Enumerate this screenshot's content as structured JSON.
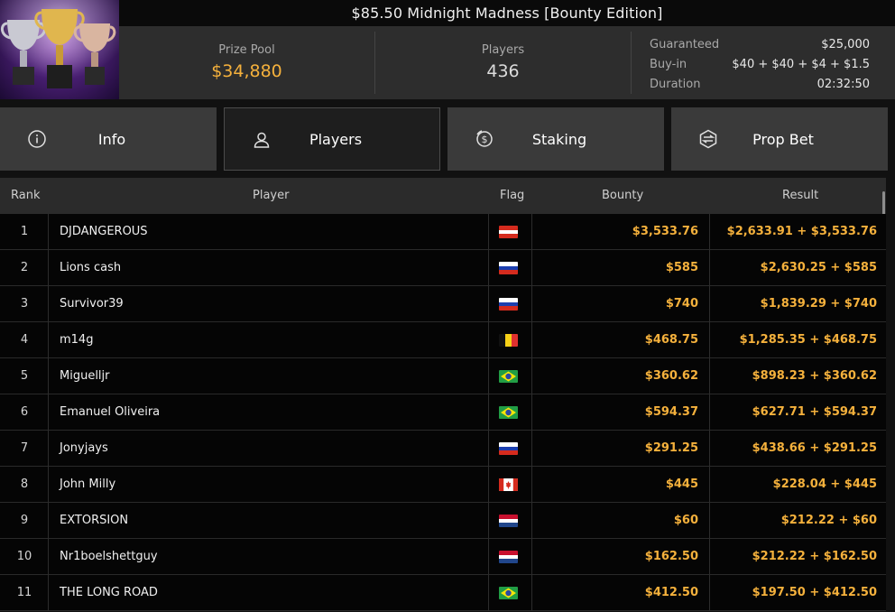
{
  "header": {
    "title": "$85.50 Midnight Madness [Bounty Edition]",
    "prize_pool_label": "Prize Pool",
    "prize_pool_value": "$34,880",
    "players_label": "Players",
    "players_value": "436",
    "details": [
      {
        "label": "Guaranteed",
        "value": "$25,000"
      },
      {
        "label": "Buy-in",
        "value": "$40 + $40 + $4 + $1.5"
      },
      {
        "label": "Duration",
        "value": "02:32:50"
      }
    ]
  },
  "tabs": [
    {
      "label": "Info",
      "icon": "info-icon",
      "active": false
    },
    {
      "label": "Players",
      "icon": "user-icon",
      "active": true
    },
    {
      "label": "Staking",
      "icon": "dollar-coin-icon",
      "active": false
    },
    {
      "label": "Prop Bet",
      "icon": "prop-bet-icon",
      "active": false
    }
  ],
  "table": {
    "columns": {
      "rank": "Rank",
      "player": "Player",
      "flag": "Flag",
      "bounty": "Bounty",
      "result": "Result"
    },
    "rows": [
      {
        "rank": "1",
        "player": "DJDANGEROUS",
        "flag": "austria",
        "bounty": "$3,533.76",
        "result": "$2,633.91 + $3,533.76"
      },
      {
        "rank": "2",
        "player": "Lions cash",
        "flag": "russia",
        "bounty": "$585",
        "result": "$2,630.25 + $585"
      },
      {
        "rank": "3",
        "player": "Survivor39",
        "flag": "russia",
        "bounty": "$740",
        "result": "$1,839.29 + $740"
      },
      {
        "rank": "4",
        "player": "m14g",
        "flag": "belgium",
        "bounty": "$468.75",
        "result": "$1,285.35 + $468.75"
      },
      {
        "rank": "5",
        "player": "Miguelljr",
        "flag": "brazil",
        "bounty": "$360.62",
        "result": "$898.23 + $360.62"
      },
      {
        "rank": "6",
        "player": "Emanuel Oliveira",
        "flag": "brazil",
        "bounty": "$594.37",
        "result": "$627.71 + $594.37"
      },
      {
        "rank": "7",
        "player": "Jonyjays",
        "flag": "russia",
        "bounty": "$291.25",
        "result": "$438.66 + $291.25"
      },
      {
        "rank": "8",
        "player": "John Milly",
        "flag": "canada",
        "bounty": "$445",
        "result": "$228.04 + $445"
      },
      {
        "rank": "9",
        "player": "EXTORSION",
        "flag": "netherlands",
        "bounty": "$60",
        "result": "$212.22 + $60"
      },
      {
        "rank": "10",
        "player": "Nr1boelshettguy",
        "flag": "netherlands",
        "bounty": "$162.50",
        "result": "$212.22 + $162.50"
      },
      {
        "rank": "11",
        "player": "THE LONG ROAD",
        "flag": "brazil",
        "bounty": "$412.50",
        "result": "$197.50 + $412.50"
      }
    ]
  },
  "colors": {
    "accent_gold": "#f5b13c",
    "background": "#111111",
    "tab_bg": "#3a3a3a"
  }
}
